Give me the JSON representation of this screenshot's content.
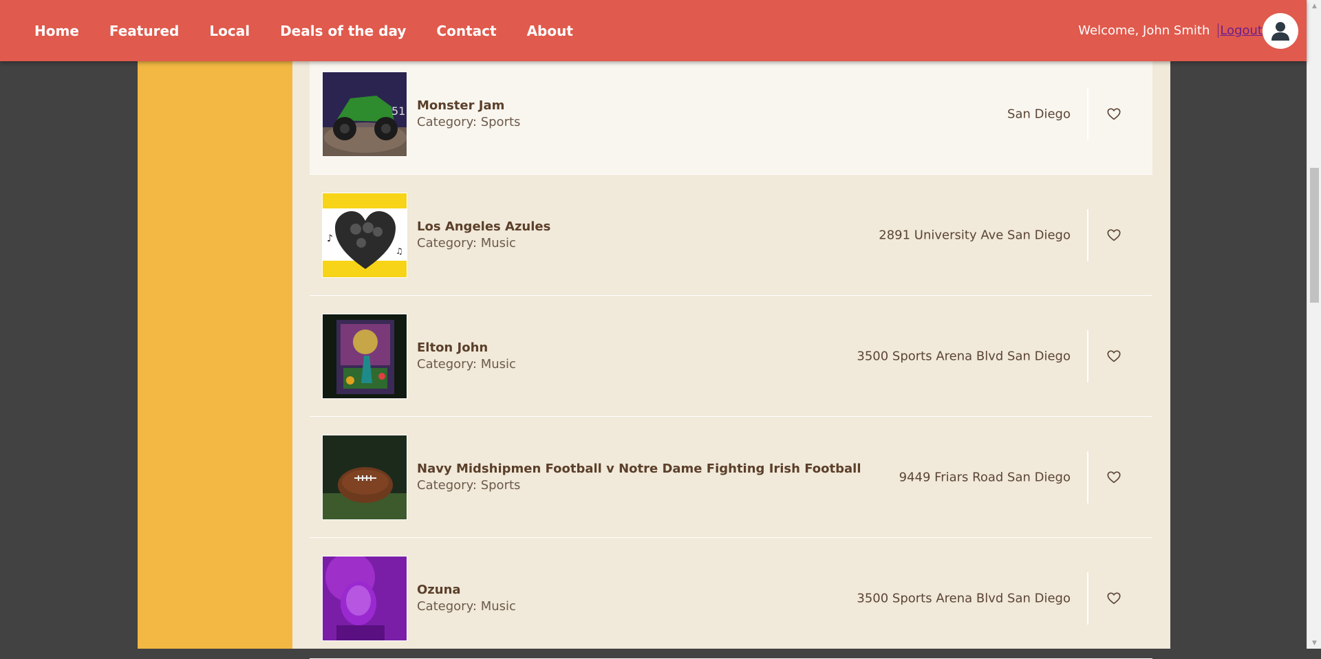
{
  "nav": {
    "items": [
      {
        "label": "Home"
      },
      {
        "label": "Featured"
      },
      {
        "label": "Local"
      },
      {
        "label": "Deals of the day"
      },
      {
        "label": "Contact"
      },
      {
        "label": "About"
      }
    ]
  },
  "user": {
    "welcome": "Welcome, John Smith",
    "logout_label": "Logout",
    "avatar_icon": "user-icon"
  },
  "colors": {
    "header": "#e05a4d",
    "sidebar": "#f2b843",
    "content": "#f1e9d9",
    "outer_background": "#424242",
    "highlight_row": "#f9f6ef"
  },
  "events": [
    {
      "title": "Monster Jam",
      "category": "Category: Sports",
      "location": "San Diego",
      "favorite_icon": "heart-outline-icon",
      "highlighted": true
    },
    {
      "title": "Los Angeles Azules",
      "category": "Category: Music",
      "location": "2891 University Ave San Diego",
      "favorite_icon": "heart-outline-icon",
      "highlighted": false
    },
    {
      "title": "Elton John",
      "category": "Category: Music",
      "location": "3500 Sports Arena Blvd San Diego",
      "favorite_icon": "heart-outline-icon",
      "highlighted": false
    },
    {
      "title": "Navy Midshipmen Football v Notre Dame Fighting Irish Football",
      "category": "Category: Sports",
      "location": "9449 Friars Road San Diego",
      "favorite_icon": "heart-outline-icon",
      "highlighted": false
    },
    {
      "title": "Ozuna",
      "category": "Category: Music",
      "location": "3500 Sports Arena Blvd San Diego",
      "favorite_icon": "heart-outline-icon",
      "highlighted": false
    }
  ]
}
